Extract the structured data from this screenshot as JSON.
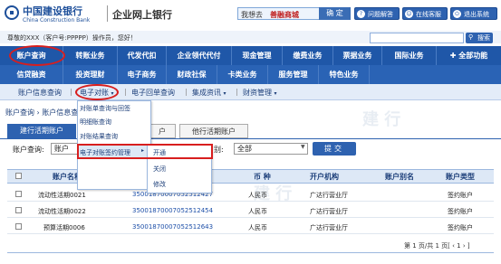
{
  "header": {
    "logo_cn": "中国建设银行",
    "logo_en": "China Construction Bank",
    "subtitle": "企业网上银行",
    "search_label": "我想去",
    "search_value": "善融商城",
    "confirm_label": "确 定",
    "help_label": "问题解答",
    "service_label": "在线客服",
    "logout_label": "退出系统"
  },
  "info": {
    "welcome": "尊敬的XXX（客户号:PPPPP）操作员，您好！",
    "search_button": "搜索"
  },
  "nav": {
    "row1": [
      "账户查询",
      "转账业务",
      "代发代扣",
      "企业领代代付",
      "现金管理",
      "缴费业务",
      "票据业务",
      "国际业务",
      "全部功能"
    ],
    "row2": [
      "信贷融资",
      "投资理财",
      "电子商务",
      "财政社保",
      "卡类业务",
      "服务管理",
      "特色业务"
    ]
  },
  "subnav": [
    "账户信息查询",
    "电子对账",
    "电子回单查询",
    "集成资讯",
    "财资管理"
  ],
  "breadcrumb": "账户查询 › 账户信息查",
  "tabs": {
    "active": "建行活期账户",
    "middle": "户",
    "other": "他行活期账户"
  },
  "query": {
    "label": "账户查询:",
    "select_value": "账户",
    "alias_label": "别:",
    "alias_value": "全部",
    "button": "提交"
  },
  "dropdown": {
    "items": [
      "对账单查询与回签",
      "明细账查询",
      "对账结果查询",
      "电子对账签约管理"
    ],
    "submenu": [
      "开通",
      "关闭",
      "修改"
    ]
  },
  "table": {
    "headers": [
      "账户名称",
      "账  号",
      "币 种",
      "开户机构",
      "账户别名",
      "账户类型"
    ],
    "rows": [
      [
        "流动性活期0021",
        "35001870007052512427",
        "人民币",
        "广达行营业厅",
        "",
        "签约账户"
      ],
      [
        "流动性活期0022",
        "35001870007052512454",
        "人民币",
        "广达行营业厅",
        "",
        "签约账户"
      ],
      [
        "预算活期0006",
        "35001870007052512643",
        "人民币",
        "广达行营业厅",
        "",
        "签约账户"
      ]
    ]
  },
  "pager": "第 1 页/共 1 页[ ‹ 1 › ]",
  "colors": {
    "primary": "#1f57a8",
    "highlight": "#d81e1e"
  }
}
